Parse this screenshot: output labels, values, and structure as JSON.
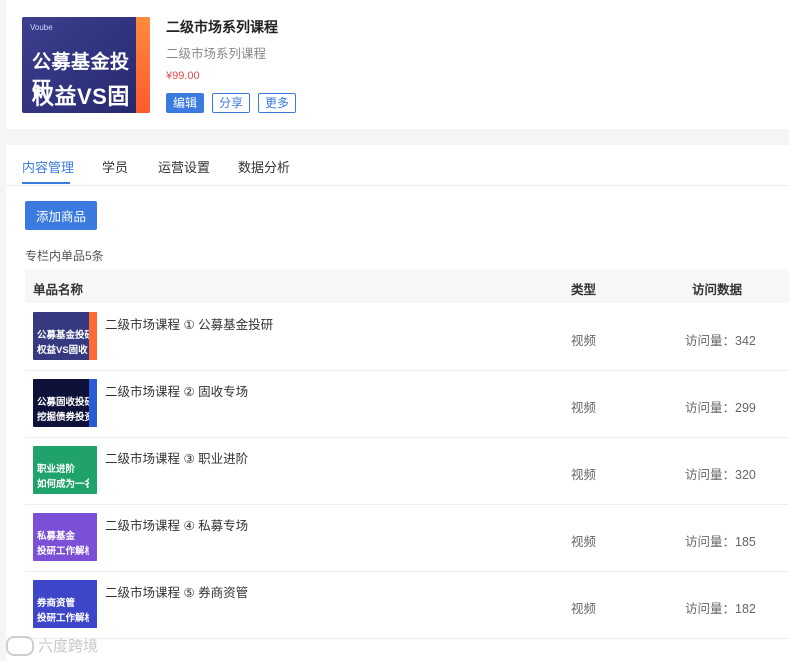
{
  "course": {
    "title": "二级市场系列课程",
    "subtitle": "二级市场系列课程",
    "price": "¥99.00",
    "cover": {
      "brand": "Voube",
      "line1": "公募基金投研",
      "line2": "权益VS固收"
    },
    "buttons": {
      "edit": "编辑",
      "share": "分享",
      "more": "更多"
    }
  },
  "tabs": [
    "内容管理",
    "学员",
    "运营设置",
    "数据分析"
  ],
  "active_tab": 0,
  "add_button": "添加商品",
  "item_count_text": "专栏内单品5条",
  "table": {
    "headers": {
      "name": "单品名称",
      "type": "类型",
      "visits": "访问数据"
    },
    "rows": [
      {
        "title": "二级市场课程 ① 公募基金投研",
        "type": "视频",
        "visits": "访问量：342",
        "thumb": {
          "line1": "公募基金投研",
          "line2": "权益VS固收",
          "bg": "#35397f",
          "accent": "#ff6a35"
        }
      },
      {
        "title": "二级市场课程 ② 固收专场",
        "type": "视频",
        "visits": "访问量：299",
        "thumb": {
          "line1": "公募固收投研",
          "line2": "挖掘债券投资之美",
          "bg": "#0f1238",
          "accent": "#2a5bd7"
        }
      },
      {
        "title": "二级市场课程 ③ 职业进阶",
        "type": "视频",
        "visits": "访问量：320",
        "thumb": {
          "line1": "职业进阶",
          "line2": "如何成为一名基金经理",
          "bg": "#1fa36a",
          "accent": "#1fa36a"
        }
      },
      {
        "title": "二级市场课程 ④ 私募专场",
        "type": "视频",
        "visits": "访问量：185",
        "thumb": {
          "line1": "私募基金",
          "line2": "投研工作解析",
          "bg": "#7b4fd6",
          "accent": "#7b4fd6"
        }
      },
      {
        "title": "二级市场课程 ⑤ 券商资管",
        "type": "视频",
        "visits": "访问量：182",
        "thumb": {
          "line1": "券商资管",
          "line2": "投研工作解析",
          "bg": "#3d46c9",
          "accent": "#3d46c9"
        }
      }
    ]
  },
  "watermark": "六度跨境",
  "colors": {
    "primary": "#3b7be0",
    "price": "#e04a4a"
  }
}
